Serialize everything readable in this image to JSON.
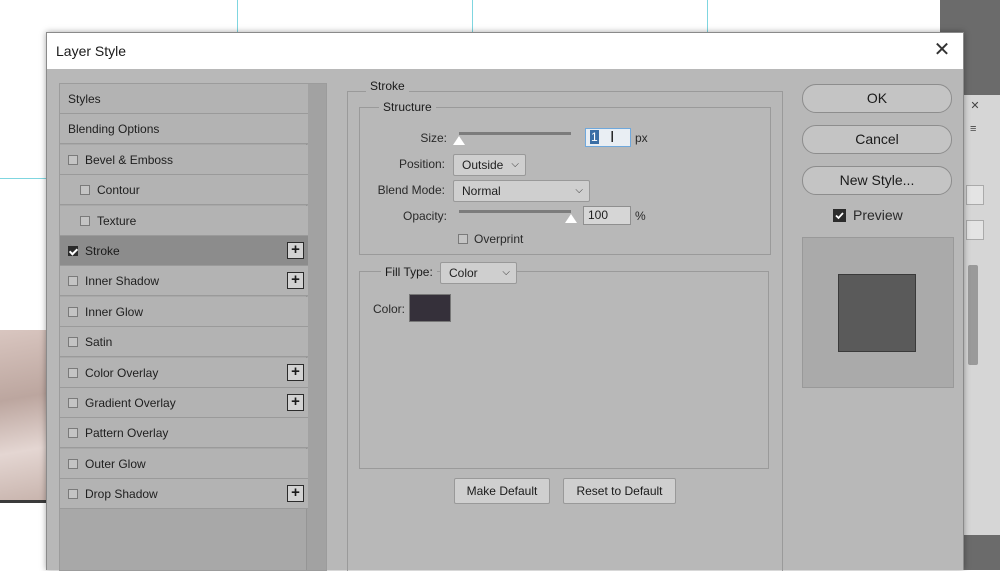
{
  "dialog": {
    "title": "Layer Style"
  },
  "styles_list": {
    "items": [
      {
        "label": "Styles",
        "checkbox": false,
        "plus": false
      },
      {
        "label": "Blending Options",
        "checkbox": false,
        "plus": false
      },
      {
        "label": "Bevel & Emboss",
        "checkbox": true,
        "checked": false,
        "plus": false
      },
      {
        "label": "Contour",
        "checkbox": true,
        "checked": false,
        "plus": false,
        "indent": true
      },
      {
        "label": "Texture",
        "checkbox": true,
        "checked": false,
        "plus": false,
        "indent": true
      },
      {
        "label": "Stroke",
        "checkbox": true,
        "checked": true,
        "plus": true,
        "selected": true
      },
      {
        "label": "Inner Shadow",
        "checkbox": true,
        "checked": false,
        "plus": true
      },
      {
        "label": "Inner Glow",
        "checkbox": true,
        "checked": false,
        "plus": false
      },
      {
        "label": "Satin",
        "checkbox": true,
        "checked": false,
        "plus": false
      },
      {
        "label": "Color Overlay",
        "checkbox": true,
        "checked": false,
        "plus": true
      },
      {
        "label": "Gradient Overlay",
        "checkbox": true,
        "checked": false,
        "plus": true
      },
      {
        "label": "Pattern Overlay",
        "checkbox": true,
        "checked": false,
        "plus": false
      },
      {
        "label": "Outer Glow",
        "checkbox": true,
        "checked": false,
        "plus": false
      },
      {
        "label": "Drop Shadow",
        "checkbox": true,
        "checked": false,
        "plus": true
      }
    ],
    "plus_symbol": "+"
  },
  "stroke": {
    "section_title": "Stroke",
    "structure_title": "Structure",
    "size_label": "Size:",
    "size_value": "1",
    "size_unit": "px",
    "size_slider_fraction": 0.0,
    "position_label": "Position:",
    "position_value": "Outside",
    "blend_mode_label": "Blend Mode:",
    "blend_mode_value": "Normal",
    "opacity_label": "Opacity:",
    "opacity_value": "100",
    "opacity_unit": "%",
    "opacity_slider_fraction": 1.0,
    "overprint_label": "Overprint",
    "overprint_checked": false,
    "fill_type_label": "Fill Type:",
    "fill_type_value": "Color",
    "color_label": "Color:",
    "color_value": "#35303a",
    "make_default_label": "Make Default",
    "reset_default_label": "Reset to Default"
  },
  "actions": {
    "ok_label": "OK",
    "cancel_label": "Cancel",
    "new_style_label": "New Style...",
    "preview_label": "Preview",
    "preview_checked": true
  },
  "icons": {
    "close": "close-icon",
    "chevron": "chevron-down-icon",
    "chevron_glyph": "⌵",
    "close_glyph": "✕",
    "checkbox_checked": "checkbox-checked-icon",
    "cursor": "text-cursor-icon",
    "cursor_glyph": "I"
  }
}
